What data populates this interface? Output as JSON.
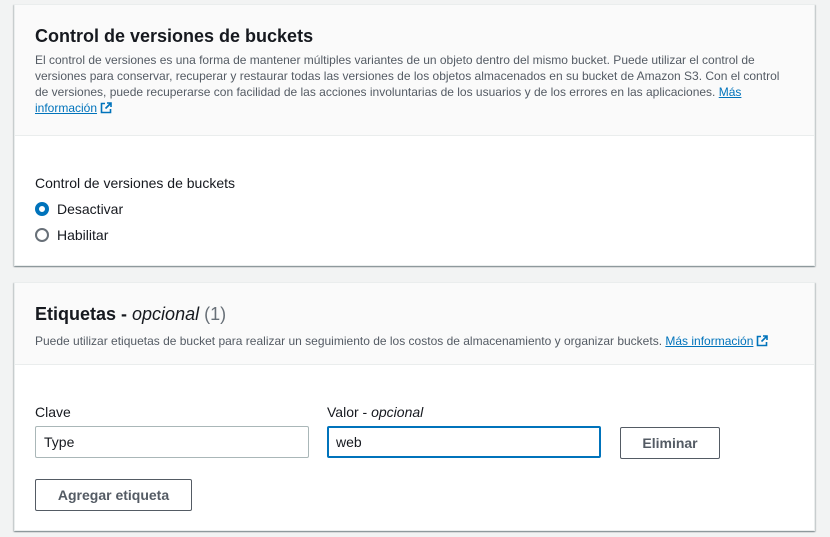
{
  "versioning": {
    "title": "Control de versiones de buckets",
    "description": "El control de versiones es una forma de mantener múltiples variantes de un objeto dentro del mismo bucket. Puede utilizar el control de versiones para conservar, recuperar y restaurar todas las versiones de los objetos almacenados en su bucket de Amazon S3. Con el control de versiones, puede recuperarse con facilidad de las acciones involuntarias de los usuarios y de los errores en las aplicaciones.",
    "more_info_link": "Más información",
    "field_label": "Control de versiones de buckets",
    "options": [
      {
        "label": "Desactivar",
        "checked": true
      },
      {
        "label": "Habilitar",
        "checked": false
      }
    ]
  },
  "tags": {
    "title": "Etiquetas",
    "title_sep": " - ",
    "title_optional": "opcional",
    "count": "(1)",
    "description": "Puede utilizar etiquetas de bucket para realizar un seguimiento de los costos de almacenamiento y organizar buckets.",
    "more_info_link": "Más información",
    "key_label": "Clave",
    "value_label": "Valor",
    "value_label_sep": " - ",
    "value_label_optional": "opcional",
    "rows": [
      {
        "key": "Type",
        "value": "web"
      }
    ],
    "remove_button": "Eliminar",
    "add_button": "Agregar etiqueta"
  },
  "colors": {
    "link": "#0073bb",
    "focus_border": "#0073bb",
    "background": "#f2f3f3"
  }
}
